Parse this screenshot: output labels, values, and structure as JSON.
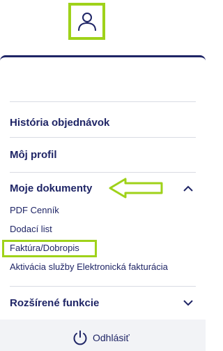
{
  "colors": {
    "navy": "#1f2566",
    "highlight_green": "#9fd21a",
    "separator": "#d9dbe3",
    "footer_bg": "#f2f3f6"
  },
  "header": {
    "user_icon": "user-icon"
  },
  "menu": {
    "items": [
      {
        "label": "História objednávok"
      },
      {
        "label": "Môj profil"
      },
      {
        "label": "Moje dokumenty",
        "expanded": true
      },
      {
        "label": "Rozšírené funkcie",
        "expanded": false
      }
    ],
    "documents_subitems": [
      {
        "label": "PDF Cenník"
      },
      {
        "label": "Dodací list"
      },
      {
        "label": "Faktúra/Dobropis",
        "highlighted": true
      },
      {
        "label": "Aktivácia služby Elektronická fakturácia"
      }
    ]
  },
  "footer": {
    "logout_label": "Odhlásiť",
    "logout_icon": "power-icon"
  }
}
